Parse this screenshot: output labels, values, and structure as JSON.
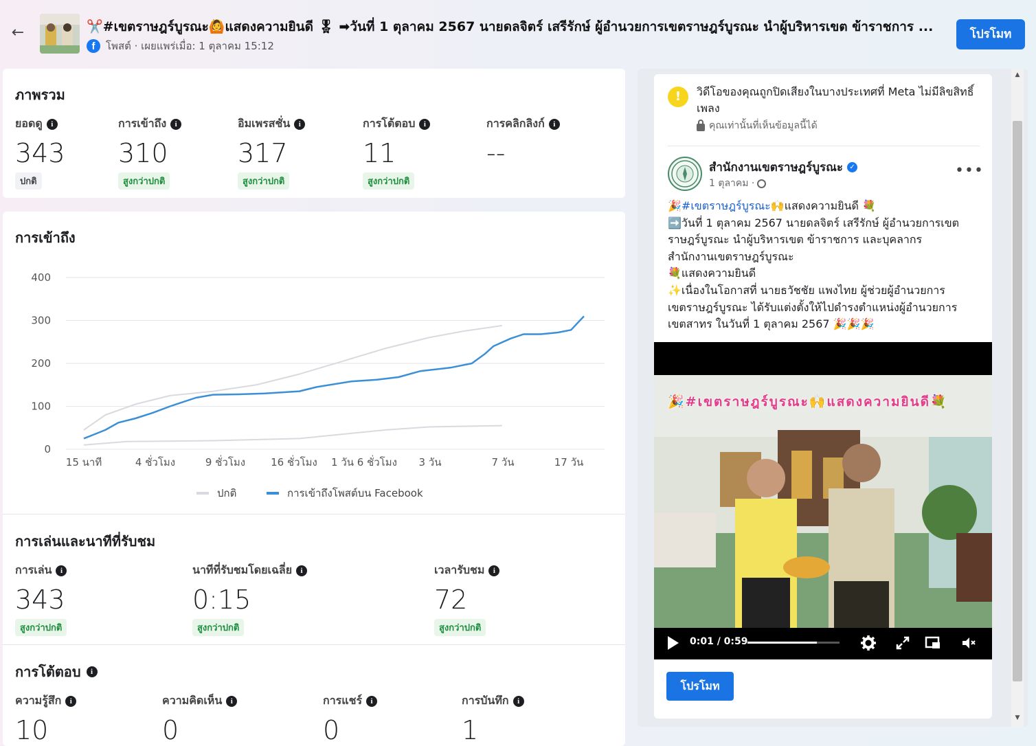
{
  "header": {
    "back_icon": "arrow-left-icon",
    "title": "✂️#เขตราษฎร์บูรณะ🙆แสดงความยินดี 🎖 ➡วันที่ 1 ตุลาคม 2567 นายดลจิตร์ เสรีรักษ์ ผู้อำนวยการเขตราษฎร์บูรณะ นำผู้บริหารเขต ข้าราชการ ...",
    "meta": "โพสต์ · เผยแพร่เมื่อ: 1 ตุลาคม 15:12",
    "promote_label": "โปรโมท"
  },
  "overview": {
    "title": "ภาพรวม",
    "stats": [
      {
        "label": "ยอดดู",
        "value": "343",
        "badge": "ปกติ"
      },
      {
        "label": "การเข้าถึง",
        "value": "310",
        "badge": "สูงกว่าปกติ"
      },
      {
        "label": "อิมเพรสชั่น",
        "value": "317",
        "badge": "สูงกว่าปกติ"
      },
      {
        "label": "การโต้ตอบ",
        "value": "11",
        "badge": "สูงกว่าปกติ"
      },
      {
        "label": "การคลิกลิงก์",
        "value": "--",
        "badge": ""
      }
    ]
  },
  "reach": {
    "title": "การเข้าถึง"
  },
  "chart_data": {
    "type": "line",
    "title": "การเข้าถึง",
    "x": [
      "15 นาที",
      "4 ชั่วโมง",
      "9 ชั่วโมง",
      "16 ชั่วโมง",
      "1 วัน 6 ชั่วโมง",
      "3 วัน",
      "7 วัน",
      "17 วัน"
    ],
    "yticks": [
      0,
      100,
      200,
      300,
      400
    ],
    "ylim": [
      0,
      400
    ],
    "grid": true,
    "legend_position": "bottom",
    "series": [
      {
        "name": "ปกติ",
        "color": "#d8dadf",
        "points": [
          [
            0,
            45
          ],
          [
            0.05,
            80
          ],
          [
            0.12,
            105
          ],
          [
            0.2,
            125
          ],
          [
            0.3,
            135
          ],
          [
            0.4,
            150
          ],
          [
            0.5,
            175
          ],
          [
            0.6,
            205
          ],
          [
            0.7,
            235
          ],
          [
            0.8,
            260
          ],
          [
            0.88,
            275
          ],
          [
            0.97,
            288
          ]
        ]
      },
      {
        "name": "ปกติ (ล่าง)",
        "color": "#d8dadf",
        "points": [
          [
            0,
            10
          ],
          [
            0.1,
            18
          ],
          [
            0.3,
            20
          ],
          [
            0.5,
            25
          ],
          [
            0.6,
            35
          ],
          [
            0.7,
            45
          ],
          [
            0.8,
            52
          ],
          [
            0.97,
            55
          ]
        ]
      },
      {
        "name": "การเข้าถึงโพสต์บน Facebook",
        "color": "#3b8fd6",
        "points": [
          [
            0,
            25
          ],
          [
            0.05,
            45
          ],
          [
            0.08,
            62
          ],
          [
            0.12,
            72
          ],
          [
            0.16,
            85
          ],
          [
            0.2,
            100
          ],
          [
            0.26,
            120
          ],
          [
            0.3,
            127
          ],
          [
            0.36,
            128
          ],
          [
            0.42,
            130
          ],
          [
            0.5,
            135
          ],
          [
            0.54,
            145
          ],
          [
            0.62,
            158
          ],
          [
            0.68,
            162
          ],
          [
            0.73,
            168
          ],
          [
            0.78,
            182
          ],
          [
            0.85,
            190
          ],
          [
            0.9,
            200
          ],
          [
            0.93,
            222
          ],
          [
            0.95,
            240
          ],
          [
            0.99,
            258
          ],
          [
            1.02,
            268
          ],
          [
            1.06,
            268
          ],
          [
            1.1,
            272
          ],
          [
            1.13,
            278
          ],
          [
            1.16,
            310
          ]
        ]
      }
    ]
  },
  "legend": [
    {
      "label": "ปกติ",
      "color": "#d8dadf"
    },
    {
      "label": "การเข้าถึงโพสต์บน Facebook",
      "color": "#3b8fd6"
    }
  ],
  "playback": {
    "title": "การเล่นและนาทีที่รับชม",
    "stats": [
      {
        "label": "การเล่น",
        "value": "343",
        "badge": "สูงกว่าปกติ"
      },
      {
        "label": "นาทีที่รับชมโดยเฉลี่ย",
        "value": "0:15",
        "badge": "สูงกว่าปกติ"
      },
      {
        "label": "เวลารับชม",
        "value": "72",
        "badge": "สูงกว่าปกติ"
      }
    ]
  },
  "interactions": {
    "title": "การโต้ตอบ",
    "stats": [
      {
        "label": "ความรู้สึก",
        "value": "10"
      },
      {
        "label": "ความคิดเห็น",
        "value": "0"
      },
      {
        "label": "การแชร์",
        "value": "0"
      },
      {
        "label": "การบันทึก",
        "value": "1"
      }
    ]
  },
  "preview": {
    "warning": "วิดีโอของคุณถูกปิดเสียงในบางประเทศที่ Meta ไม่มีลิขสิทธิ์เพลง",
    "warning_sub": "คุณเท่านั้นที่เห็นข้อมูลนี้ได้",
    "page_name": "สำนักงานเขตราษฎร์บูรณะ",
    "date": "1 ตุลาคม ·",
    "body_lines": [
      "🎉#เขตราษฎร์บูรณะ🙌แสดงความยินดี 💐",
      "➡️วันที่ 1 ตุลาคม 2567 นายดลจิตร์ เสรีรักษ์ ผู้อำนวยการเขต",
      "ราษฎร์บูรณะ นำผู้บริหารเขต ข้าราชการ และบุคลากร",
      "สำนักงานเขตราษฎร์บูรณะ",
      "💐แสดงความยินดี",
      "✨เนื่องในโอกาสที่ นายธวัชชัย แพงไทย ผู้ช่วยผู้อำนวยการ",
      "เขตราษฎร์บูรณะ ได้รับแต่งตั้งให้ไปดำรงตำแหน่งผู้อำนวยการ",
      "เขตสาทร ในวันที่ 1 ตุลาคม 2567 🎉🎉🎉"
    ],
    "video_caption": "🎉#เขตราษฎร์บูรณะ🙌แสดงความยินดี💐",
    "video_time": "0:01 / 0:59",
    "video_progress": 0.75,
    "promote_label": "โปรโมท"
  }
}
